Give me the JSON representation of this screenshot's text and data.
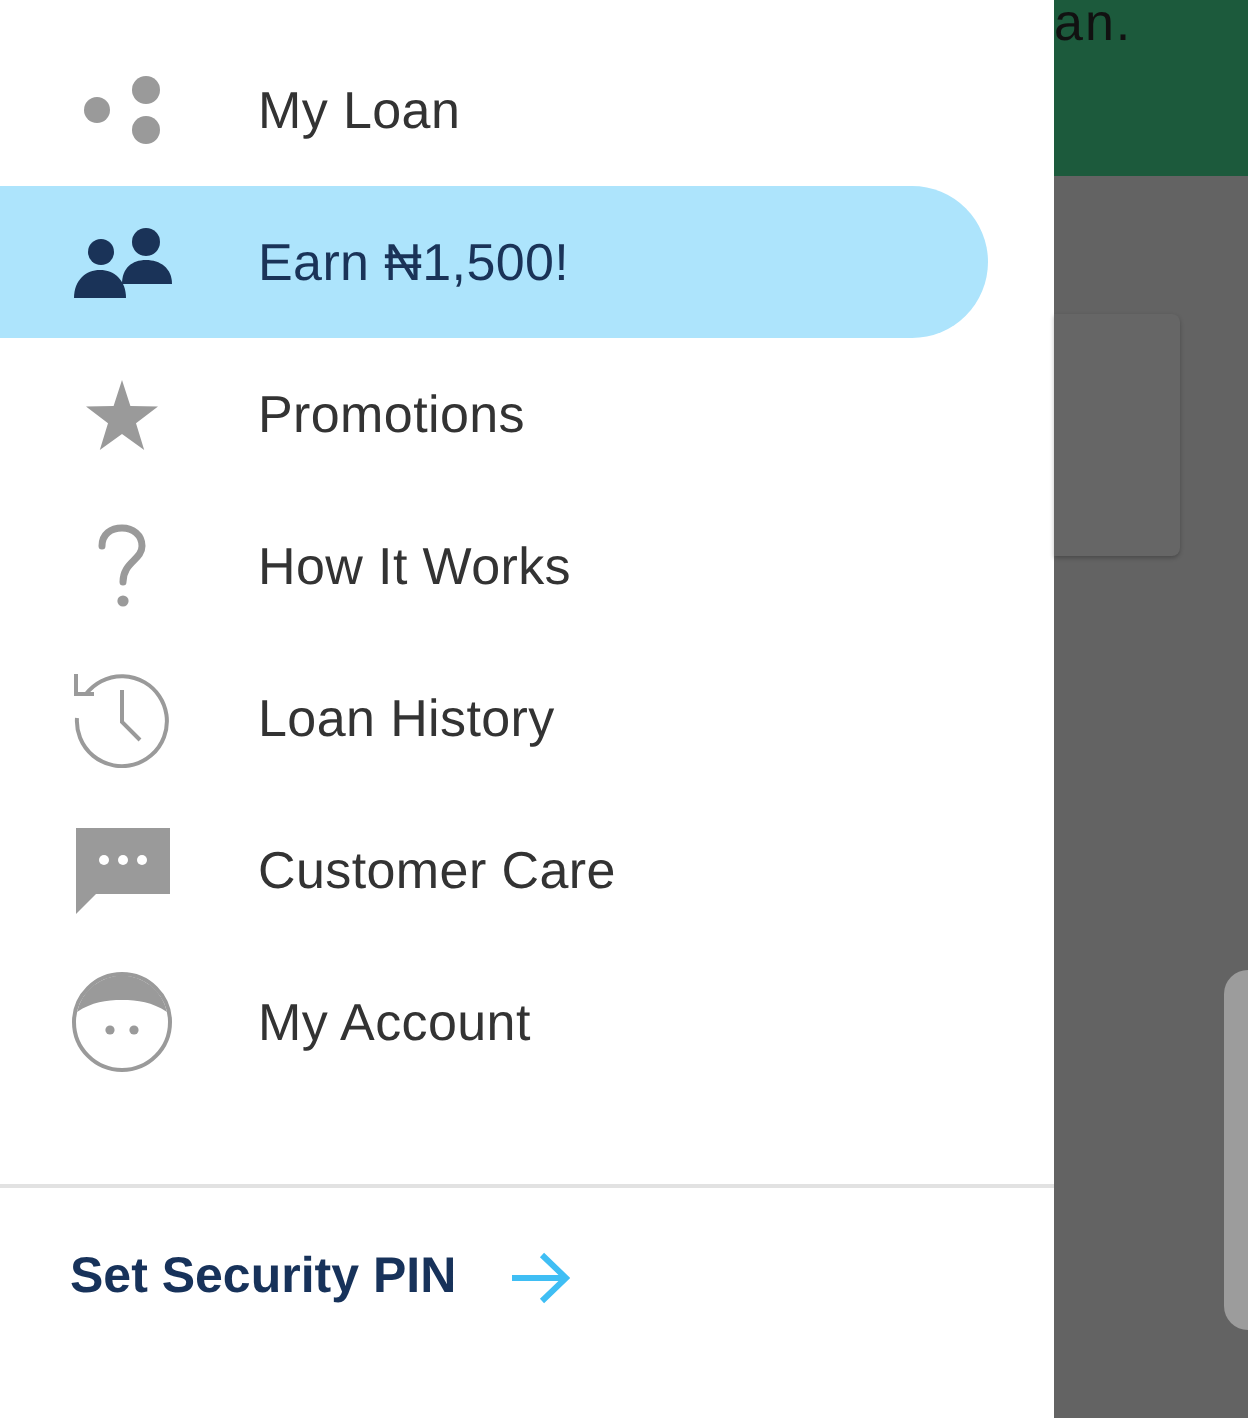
{
  "background": {
    "header_text": "an."
  },
  "menu": {
    "items": [
      {
        "label": "My Loan",
        "selected": false
      },
      {
        "label": "Earn ₦1,500!",
        "selected": true
      },
      {
        "label": "Promotions",
        "selected": false
      },
      {
        "label": "How It Works",
        "selected": false
      },
      {
        "label": "Loan History",
        "selected": false
      },
      {
        "label": "Customer Care",
        "selected": false
      },
      {
        "label": "My Account",
        "selected": false
      }
    ]
  },
  "footer": {
    "label": "Set Security PIN"
  }
}
